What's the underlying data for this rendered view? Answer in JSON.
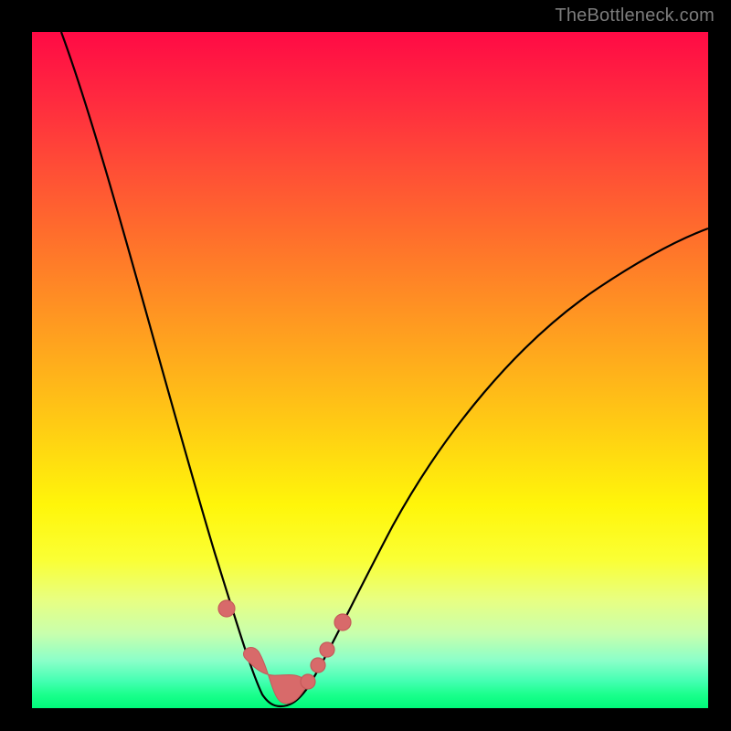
{
  "watermark": "TheBottleneck.com",
  "colors": {
    "frame": "#000000",
    "gradient_top": "#ff0a45",
    "gradient_bottom": "#00f97a",
    "curve": "#000000",
    "marker": "#d86a6a"
  },
  "chart_data": {
    "type": "line",
    "title": "",
    "xlabel": "",
    "ylabel": "",
    "xlim": [
      0,
      100
    ],
    "ylim": [
      0,
      100
    ],
    "grid": false,
    "legend": false,
    "series": [
      {
        "name": "bottleneck",
        "x": [
          0,
          5,
          10,
          15,
          20,
          25,
          27,
          29,
          31,
          33,
          34,
          35,
          36,
          38,
          40,
          45,
          50,
          55,
          60,
          65,
          70,
          75,
          80,
          85,
          90,
          95,
          100
        ],
        "y": [
          100,
          84,
          68,
          52,
          37,
          21,
          15,
          9,
          4,
          1,
          0,
          0,
          0,
          2,
          6,
          16,
          26,
          34,
          41,
          47,
          52,
          57,
          61,
          64,
          67,
          69,
          71
        ]
      }
    ],
    "markers": {
      "name": "highlighted-points",
      "x": [
        27,
        30,
        32,
        33,
        34,
        35,
        36,
        38,
        40,
        41,
        42
      ],
      "y": [
        15,
        6,
        2,
        1,
        0,
        0,
        0,
        2,
        6,
        8,
        10
      ]
    }
  }
}
